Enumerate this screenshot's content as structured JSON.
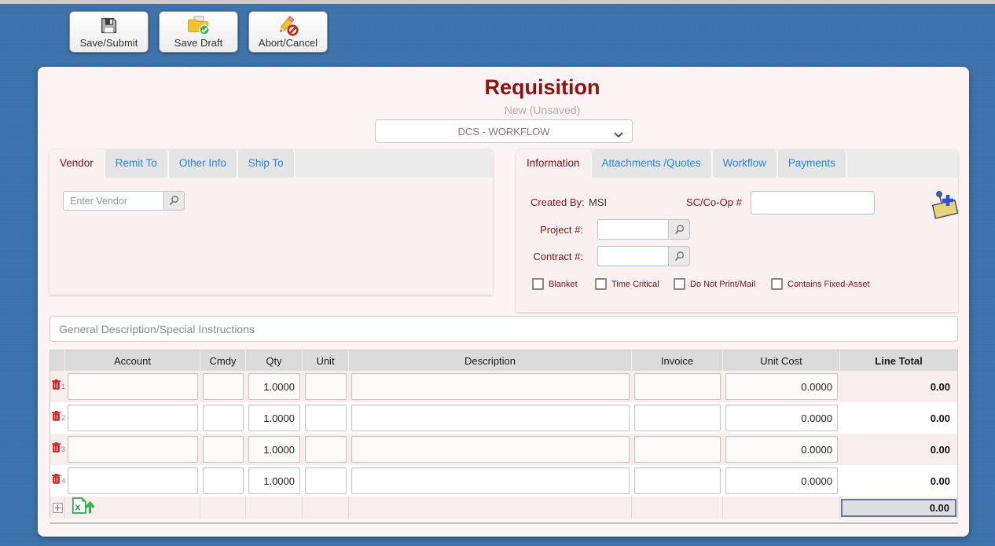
{
  "toolbar": {
    "buttons": [
      {
        "label": "Save/Submit",
        "icon": "floppy-disk-icon"
      },
      {
        "label": "Save Draft",
        "icon": "folder-check-icon"
      },
      {
        "label": "Abort/Cancel",
        "icon": "pencil-cancel-icon"
      }
    ]
  },
  "header": {
    "title": "Requisition",
    "status": "New (Unsaved)",
    "workflow": "DCS - WORKFLOW"
  },
  "vendor_card": {
    "tabs": [
      {
        "label": "Vendor",
        "active": true
      },
      {
        "label": "Remit To",
        "active": false
      },
      {
        "label": "Other Info",
        "active": false
      },
      {
        "label": "Ship To",
        "active": false
      }
    ],
    "vendor_placeholder": "Enter Vendor",
    "vendor_value": ""
  },
  "info_card": {
    "tabs": [
      {
        "label": "Information",
        "active": true
      },
      {
        "label": "Attachments /Quotes",
        "active": false
      },
      {
        "label": "Workflow",
        "active": false
      },
      {
        "label": "Payments",
        "active": false
      }
    ],
    "created_by_label": "Created By:",
    "created_by_value": "MSI",
    "sc_coop_label": "SC/Co-Op #",
    "sc_coop_value": "",
    "project_label": "Project #:",
    "project_value": "",
    "contract_label": "Contract #:",
    "contract_value": "",
    "checkboxes": [
      {
        "label": "Blanket",
        "checked": false
      },
      {
        "label": "Time Critical",
        "checked": false
      },
      {
        "label": "Do Not Print/Mail",
        "checked": false
      },
      {
        "label": "Contains Fixed-Asset",
        "checked": false
      }
    ]
  },
  "general_description": {
    "placeholder": "General Description/Special Instructions",
    "value": ""
  },
  "line_items": {
    "columns": [
      "Account",
      "Cmdy",
      "Qty",
      "Unit",
      "Description",
      "Invoice",
      "Unit Cost",
      "Line Total"
    ],
    "rows": [
      {
        "num": "1",
        "account": "",
        "cmdy": "",
        "qty": "1.0000",
        "unit": "",
        "description": "",
        "invoice": "",
        "unit_cost": "0.0000",
        "line_total": "0.00"
      },
      {
        "num": "2",
        "account": "",
        "cmdy": "",
        "qty": "1.0000",
        "unit": "",
        "description": "",
        "invoice": "",
        "unit_cost": "0.0000",
        "line_total": "0.00"
      },
      {
        "num": "3",
        "account": "",
        "cmdy": "",
        "qty": "1.0000",
        "unit": "",
        "description": "",
        "invoice": "",
        "unit_cost": "0.0000",
        "line_total": "0.00"
      },
      {
        "num": "4",
        "account": "",
        "cmdy": "",
        "qty": "1.0000",
        "unit": "",
        "description": "",
        "invoice": "",
        "unit_cost": "0.0000",
        "line_total": "0.00"
      }
    ],
    "grand_total": "0.00"
  },
  "colors": {
    "background_blue": "#3D73AB",
    "title_maroon": "#8E1212",
    "tab_blue": "#2787E0",
    "label_maroon": "#7D1315"
  }
}
